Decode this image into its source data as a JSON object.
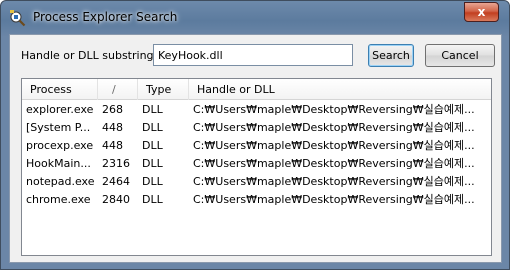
{
  "window": {
    "title": "Process Explorer Search",
    "close_label": "x"
  },
  "search": {
    "label": "Handle or DLL substring:",
    "value": "KeyHook.dll"
  },
  "buttons": {
    "search": "Search",
    "cancel": "Cancel"
  },
  "table": {
    "headers": [
      "Process",
      "/",
      "Type",
      "Handle or DLL"
    ],
    "rows": [
      {
        "process": "explorer.exe",
        "pid": "268",
        "type": "DLL",
        "path": "C:₩Users₩maple₩Desktop₩Reversing₩실습예제..."
      },
      {
        "process": "[System P...",
        "pid": "448",
        "type": "DLL",
        "path": "C:₩Users₩maple₩Desktop₩Reversing₩실습예제..."
      },
      {
        "process": "procexp.exe",
        "pid": "448",
        "type": "DLL",
        "path": "C:₩Users₩maple₩Desktop₩Reversing₩실습예제..."
      },
      {
        "process": "HookMain...",
        "pid": "2316",
        "type": "DLL",
        "path": "C:₩Users₩maple₩Desktop₩Reversing₩실습예제..."
      },
      {
        "process": "notepad.exe",
        "pid": "2464",
        "type": "DLL",
        "path": "C:₩Users₩maple₩Desktop₩Reversing₩실습예제..."
      },
      {
        "process": "chrome.exe",
        "pid": "2840",
        "type": "DLL",
        "path": "C:₩Users₩maple₩Desktop₩Reversing₩실습예제..."
      }
    ]
  },
  "colors": {
    "titlebar": "#5c7b9e",
    "close": "#c23f20",
    "client": "#f0f0f0"
  },
  "icons": {
    "app": "process-explorer-icon",
    "close": "close-icon"
  }
}
